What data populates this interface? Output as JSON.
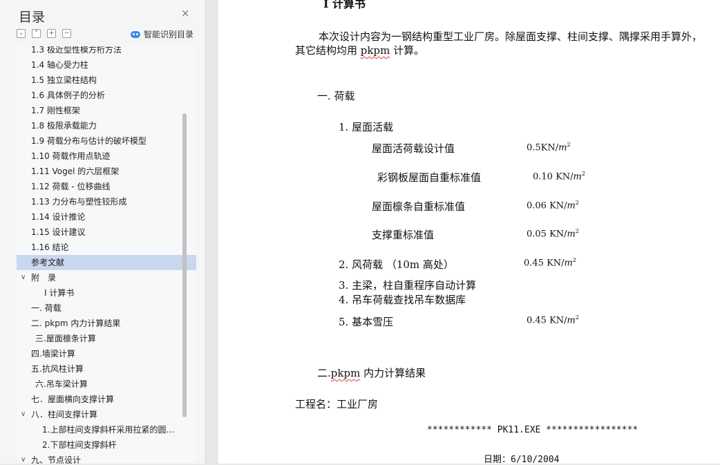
{
  "sidebar": {
    "title": "目录",
    "close_glyph": "×",
    "toolbar": {
      "collapse_glyph": "⌄",
      "up_glyph": "⌃",
      "expand_glyph": "+",
      "minus_glyph": "−",
      "ai_label": "智能识别目录"
    },
    "items": [
      {
        "label": "1.3 极近型性模方桁方法",
        "indent": 21
      },
      {
        "label": "1.4 轴心受力柱",
        "indent": 21
      },
      {
        "label": "1.5 独立梁柱结构",
        "indent": 21
      },
      {
        "label": "1.6 具体例子的分析",
        "indent": 21
      },
      {
        "label": "1.7 刚性框架",
        "indent": 21
      },
      {
        "label": "1.8 极限承载能力",
        "indent": 21
      },
      {
        "label": "1.9 荷载分布与估计的破坏模型",
        "indent": 21
      },
      {
        "label": "1.10 荷载作用点轨迹",
        "indent": 21
      },
      {
        "label": "1.11 Vogel 的六层框架",
        "indent": 21
      },
      {
        "label": "1.12 荷载 - 位移曲线",
        "indent": 21
      },
      {
        "label": "1.13 力分布与塑性铰形成",
        "indent": 21
      },
      {
        "label": "1.14 设计推论",
        "indent": 21
      },
      {
        "label": "1.15 设计建议",
        "indent": 21
      },
      {
        "label": "1.16 结论",
        "indent": 21
      },
      {
        "label": "参考文献",
        "indent": 21,
        "selected": true
      },
      {
        "label": "附　录",
        "indent": 21,
        "chevron": "∨"
      },
      {
        "label": "Ⅰ 计算书",
        "indent": 40
      },
      {
        "label": "一. 荷载",
        "indent": 21
      },
      {
        "label": "二. pkpm 内力计算结果",
        "indent": 21
      },
      {
        "label": "三.屋面檩条计算",
        "indent": 27
      },
      {
        "label": "四.墙梁计算",
        "indent": 21
      },
      {
        "label": "五.抗风柱计算",
        "indent": 21
      },
      {
        "label": "六.吊车梁计算",
        "indent": 27
      },
      {
        "label": "七．屋面横向支撑计算",
        "indent": 21
      },
      {
        "label": "八．柱间支撑计算",
        "indent": 21,
        "chevron": "∨"
      },
      {
        "label": "1.上部柱间支撑斜杆采用拉紧的圆…",
        "indent": 37
      },
      {
        "label": "2.下部柱间支撑斜杆",
        "indent": 37
      },
      {
        "label": "九、节点设计",
        "indent": 21,
        "chevron": "∨"
      }
    ]
  },
  "document": {
    "top_heading": "Ⅰ 计算书",
    "intro_line1": "本次设计内容为一钢结构重型工业厂房。除屋面支撑、柱间支撑、隅撑采用手算外，",
    "intro_line2_pre": "其它结构均用 ",
    "intro_line2_word": "pkpm",
    "intro_line2_post": " 计算。",
    "section1": "一. 荷载",
    "item1": "1.  屋面活载",
    "loads": [
      {
        "name": "屋面活荷载设计值",
        "value": "0.5KN/"
      },
      {
        "name": "彩钢板屋面自重标准值",
        "value": "0.10 KN/"
      },
      {
        "name": "屋面檩条自重标准值",
        "value": "0.06 KN/"
      },
      {
        "name": "支撑重标准值",
        "value": "0.05 KN/"
      }
    ],
    "unit_m": "m",
    "unit_exp": "2",
    "item2": "2.   风荷载  （10m 高处）",
    "item2_value": "0.45 KN/",
    "item3": "3.   主梁，柱自重程序自动计算",
    "item4": "4.   吊车荷载查找吊车数据库",
    "item5": "5.   基本雪压",
    "item5_value": "0.45 KN/",
    "section2_pre": "二.",
    "section2_word": "pkpm",
    "section2_post": " 内力计算结果",
    "project": "工程名：工业厂房",
    "program_line": "************  PK11.EXE  *****************",
    "date": "日期：6/10/2004"
  }
}
